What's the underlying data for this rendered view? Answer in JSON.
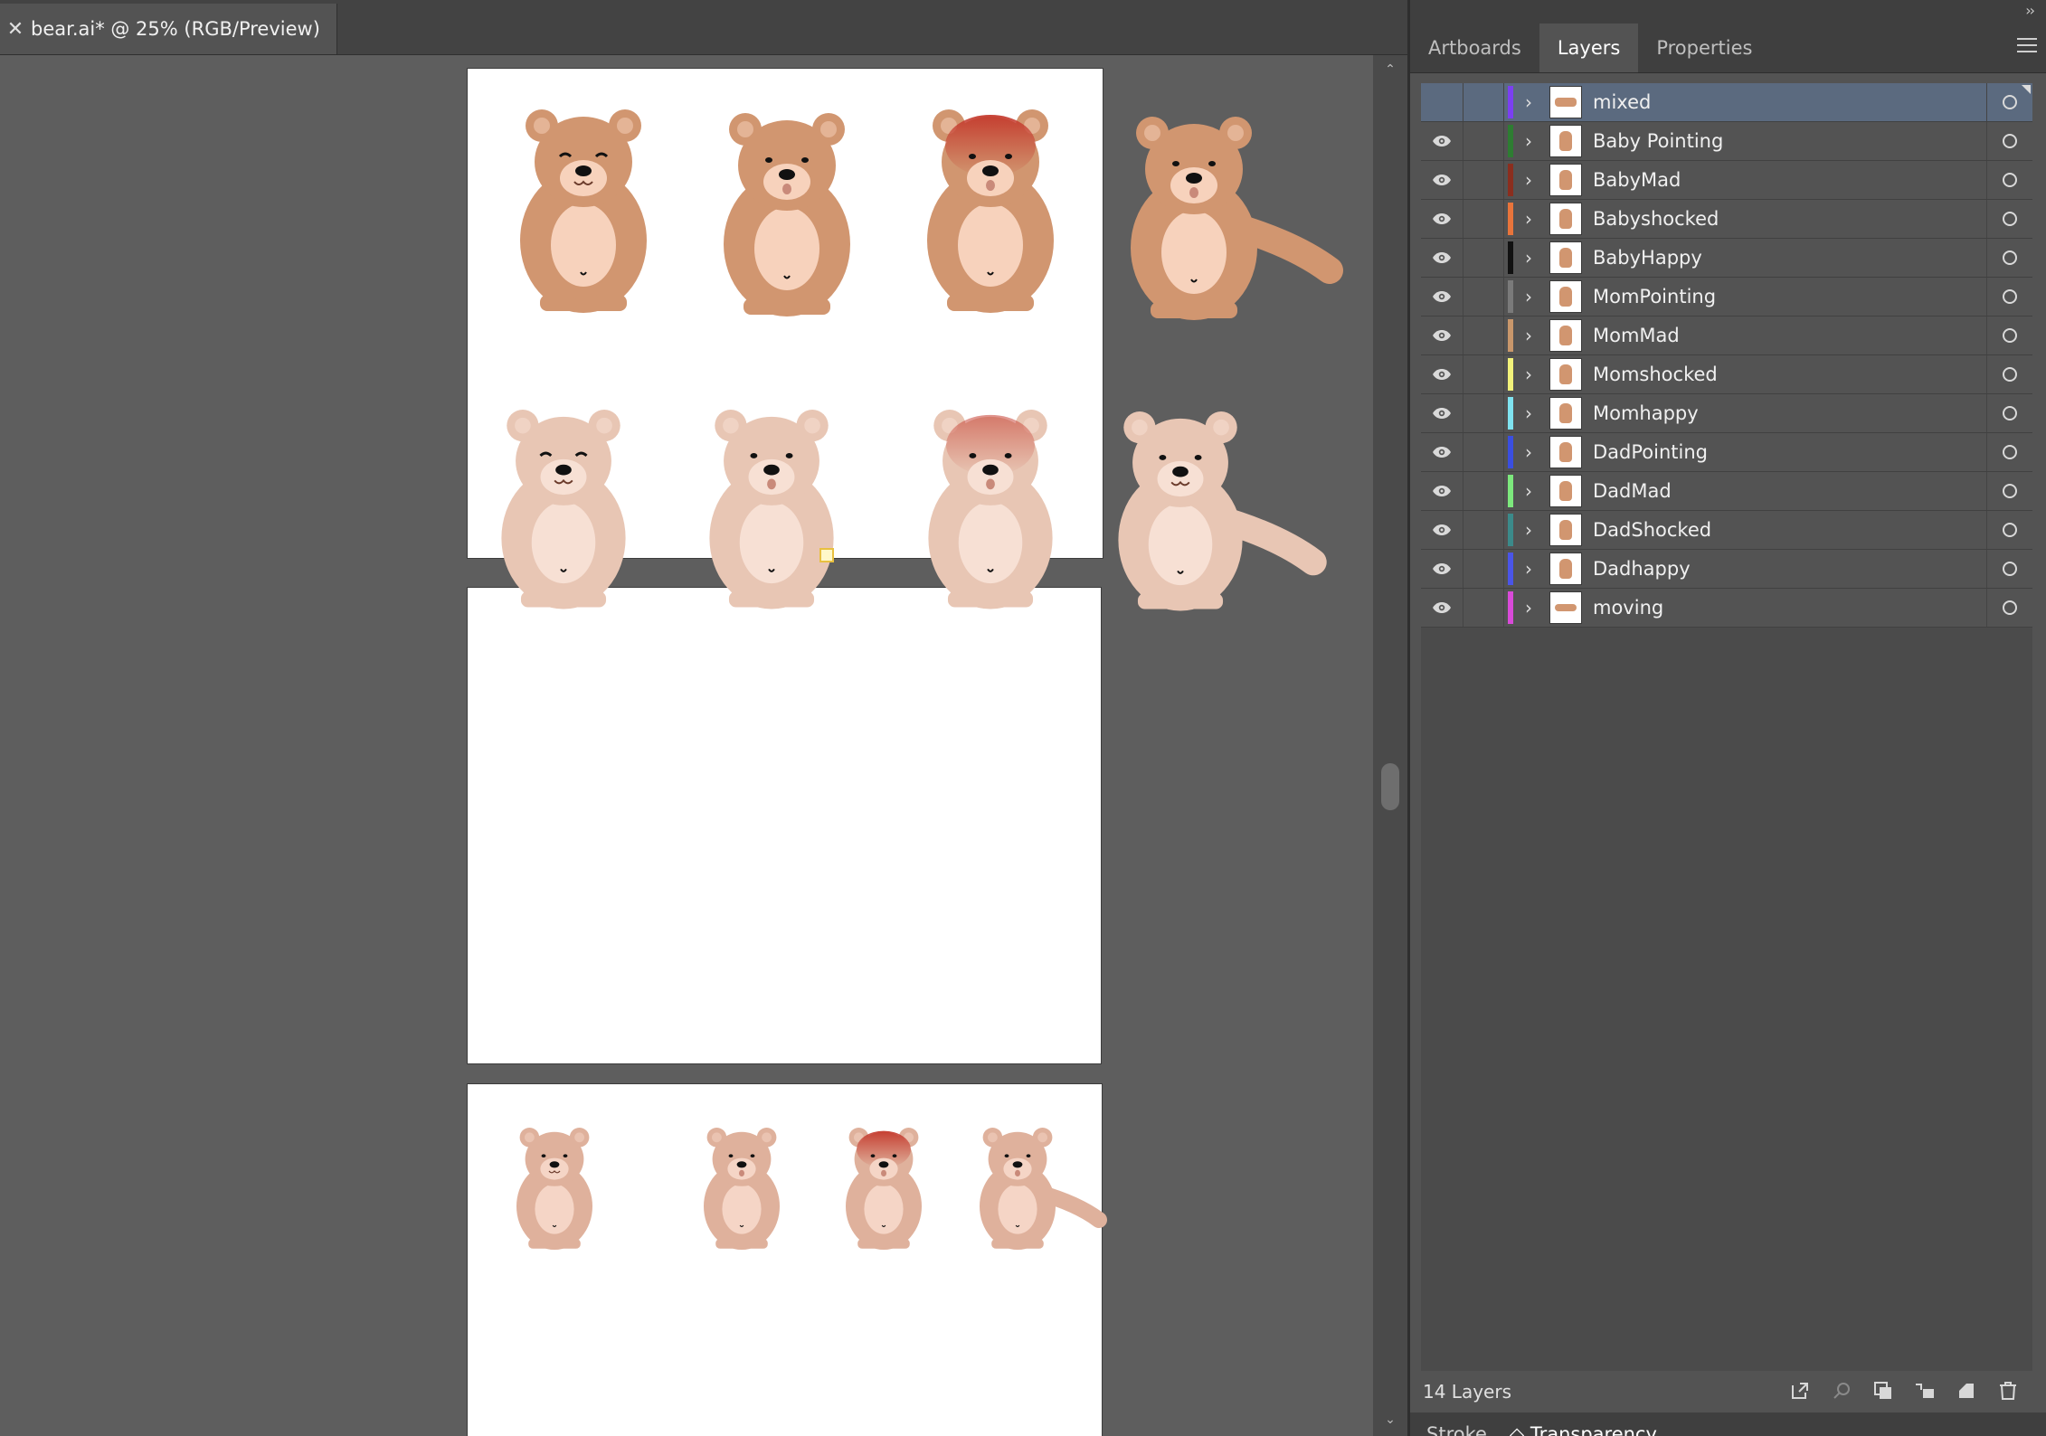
{
  "document": {
    "tab_title": "bear.ai* @ 25% (RGB/Preview)",
    "close_glyph": "✕"
  },
  "panel": {
    "tabs": [
      {
        "label": "Artboards",
        "active": false
      },
      {
        "label": "Layers",
        "active": true
      },
      {
        "label": "Properties",
        "active": false
      }
    ],
    "collapse_glyph": "››"
  },
  "layers": [
    {
      "name": "mixed",
      "color": "#7b3ff2",
      "visible": false,
      "selected": true,
      "thumb": "group"
    },
    {
      "name": "Baby Pointing",
      "color": "#2e7d32",
      "visible": true,
      "thumb": "bear"
    },
    {
      "name": "BabyMad",
      "color": "#8b2e1e",
      "visible": true,
      "thumb": "bear"
    },
    {
      "name": "Babyshocked",
      "color": "#e8743b",
      "visible": true,
      "thumb": "bear"
    },
    {
      "name": "BabyHappy",
      "color": "#111111",
      "visible": true,
      "thumb": "bear"
    },
    {
      "name": "MomPointing",
      "color": "#7a7a7a",
      "visible": true,
      "thumb": "bear"
    },
    {
      "name": "MomMad",
      "color": "#c9976b",
      "visible": true,
      "thumb": "bear"
    },
    {
      "name": "Momshocked",
      "color": "#f2f27a",
      "visible": true,
      "thumb": "bear"
    },
    {
      "name": "Momhappy",
      "color": "#7fe3f0",
      "visible": true,
      "thumb": "bear"
    },
    {
      "name": "DadPointing",
      "color": "#3a4ee0",
      "visible": true,
      "thumb": "bear"
    },
    {
      "name": "DadMad",
      "color": "#7de87d",
      "visible": true,
      "thumb": "bear"
    },
    {
      "name": "DadShocked",
      "color": "#3b8a8a",
      "visible": true,
      "thumb": "bear"
    },
    {
      "name": "Dadhappy",
      "color": "#4a55e8",
      "visible": true,
      "thumb": "bear"
    },
    {
      "name": "moving",
      "color": "#d94ad9",
      "visible": true,
      "thumb": "strip"
    }
  ],
  "footer": {
    "layer_count": "14 Layers"
  },
  "bottom_tabs": {
    "stroke": "Stroke",
    "transparency": "◇ Transparency"
  },
  "colors": {
    "bear_dark": "#d19670",
    "bear_light": "#e8c6b4",
    "bear_mid": "#dfb19c",
    "belly": "#f7d2bc",
    "mad": "#c4392c"
  }
}
